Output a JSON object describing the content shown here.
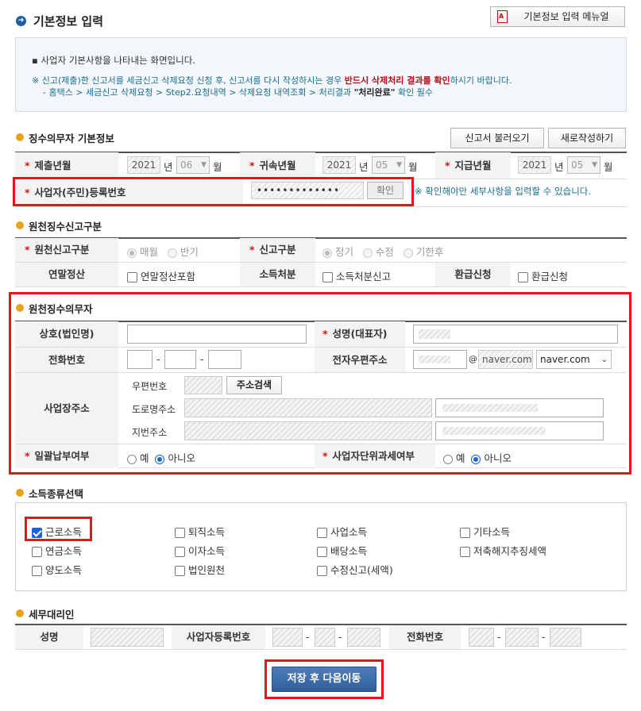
{
  "header": {
    "title": "기본정보 입력",
    "manual_button": "기본정보 입력 메뉴얼"
  },
  "info": {
    "line1": "사업자 기본사항을 나타내는 화면입니다.",
    "line2_pre": "※ 신고(제출)한 신고서를 세금신고 삭제요청 신청 후, 신고서를 다시 작성하시는 경우 ",
    "line2_strong": "반드시 삭제처리 결과를 확인",
    "line2_post": "하시기 바랍니다.",
    "line3_pre": "- 홈택스 > 세금신고 삭제요청 > Step2.요청내역 > 삭제요청 내역조회 > 처리결과 ",
    "line3_strong": "\"처리완료\"",
    "line3_post": " 확인 필수"
  },
  "withholding_basic": {
    "title": "징수의무자 기본정보",
    "load_button": "신고서 불러오기",
    "new_button": "새로작성하기",
    "submit_label": "제출년월",
    "submit_year": "2021",
    "submit_month": "06",
    "belong_label": "귀속년월",
    "belong_year": "2021",
    "belong_month": "05",
    "pay_label": "지급년월",
    "pay_year": "2021",
    "pay_month": "05",
    "year_unit": "년",
    "month_unit": "월",
    "reg_label": "사업자(주민)등록번호",
    "reg_value": "•••••••••••••",
    "confirm_button": "확인",
    "confirm_note": "※ 확인해야만 세부사항을 입력할 수 있습니다."
  },
  "report_type": {
    "title": "원천징수신고구분",
    "type_label": "원천신고구분",
    "type_options": [
      "매월",
      "반기"
    ],
    "kind_label": "신고구분",
    "kind_options": [
      "정기",
      "수정",
      "기한후"
    ],
    "yearend_label": "연말정산",
    "yearend_option": "연말정산포함",
    "income_label": "소득처분",
    "income_option": "소득처분신고",
    "refund_label": "환급신청",
    "refund_option": "환급신청"
  },
  "agent": {
    "title": "원천징수의무자",
    "company_label": "상호(법인명)",
    "ceo_label": "성명(대표자)",
    "phone_label": "전화번호",
    "email_label": "전자우편주소",
    "email_at": "@",
    "email_domain": "naver.com",
    "email_select": "naver.com",
    "address_label": "사업장주소",
    "zip_label": "우편번호",
    "address_search_button": "주소검색",
    "road_label": "도로명주소",
    "lot_label": "지번주소",
    "bulk_label": "일괄납부여부",
    "unit_label": "사업자단위과세여부",
    "yes": "예",
    "no": "아니오"
  },
  "income_types": {
    "title": "소득종류선택",
    "items": [
      {
        "label": "근로소득",
        "checked": true
      },
      {
        "label": "퇴직소득",
        "checked": false
      },
      {
        "label": "사업소득",
        "checked": false
      },
      {
        "label": "기타소득",
        "checked": false
      },
      {
        "label": "연금소득",
        "checked": false
      },
      {
        "label": "이자소득",
        "checked": false
      },
      {
        "label": "배당소득",
        "checked": false
      },
      {
        "label": "저축해지추징세액",
        "checked": false
      },
      {
        "label": "양도소득",
        "checked": false
      },
      {
        "label": "법인원천",
        "checked": false
      },
      {
        "label": "수정신고(세액)",
        "checked": false
      }
    ]
  },
  "tax_agent": {
    "title": "세무대리인",
    "name_label": "성명",
    "biz_label": "사업자등록번호",
    "phone_label": "전화번호"
  },
  "footer": {
    "save_button": "저장 후 다음이동"
  },
  "colors": {
    "accent_blue": "#1f5fa5",
    "highlight_red": "#e6141e",
    "note_teal": "#1a6e8e",
    "warning_red": "#b5121b"
  }
}
